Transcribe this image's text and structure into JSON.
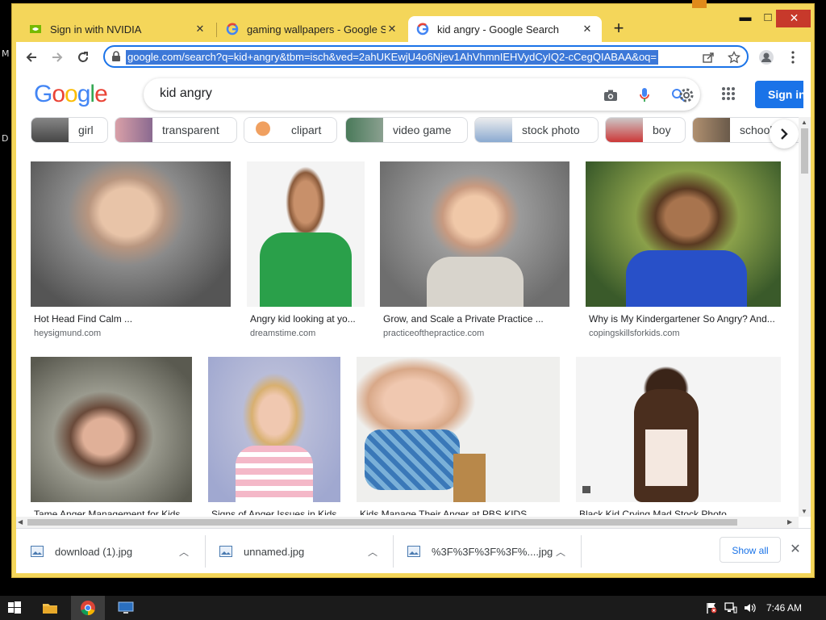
{
  "desktop": {
    "edge_letters": [
      "M",
      "D"
    ]
  },
  "tabs": [
    {
      "title": "Sign in with NVIDIA",
      "close": "✕",
      "favicon": "nvidia-icon"
    },
    {
      "title": "gaming wallpapers - Google Sea",
      "close": "✕",
      "favicon": "google-icon"
    },
    {
      "title": "kid angry - Google Search",
      "close": "✕",
      "favicon": "google-icon"
    }
  ],
  "window_controls": {
    "minimize": "▬",
    "maximize": "□",
    "close": "✕"
  },
  "toolbar": {
    "url": "google.com/search?q=kid+angry&tbm=isch&ved=2ahUKEwjU4o6Njev1AhVhmnIEHVydCyIQ2-cCegQIABAA&oq=",
    "new_tab": "+"
  },
  "google": {
    "logo_letters": [
      "G",
      "o",
      "o",
      "g",
      "l",
      "e"
    ],
    "query": "kid angry",
    "sign_in": "Sign in"
  },
  "chips": [
    {
      "label": "girl"
    },
    {
      "label": "transparent"
    },
    {
      "label": "clipart"
    },
    {
      "label": "video game"
    },
    {
      "label": "stock photo"
    },
    {
      "label": "boy"
    },
    {
      "label": "school"
    }
  ],
  "results": [
    {
      "title": "Hot Head Find Calm ...",
      "source": "heysigmund.com"
    },
    {
      "title": "Angry kid looking at yo...",
      "source": "dreamstime.com"
    },
    {
      "title": "Grow, and Scale a Private Practice ...",
      "source": "practiceofthepractice.com"
    },
    {
      "title": "Why is My Kindergartener So Angry? And...",
      "source": "copingskillsforkids.com"
    },
    {
      "title": "Tame Anger Management for Kids",
      "source": ""
    },
    {
      "title": "Signs of Anger Issues in Kids",
      "source": ""
    },
    {
      "title": "Kids Manage Their Anger at PBS KIDS",
      "source": ""
    },
    {
      "title": "Black Kid Crying Mad Stock Photo",
      "source": ""
    }
  ],
  "downloads": [
    {
      "name": "download (1).jpg"
    },
    {
      "name": "unnamed.jpg"
    },
    {
      "name": "%3F%3F%3F%3F%....jpg"
    }
  ],
  "shelf": {
    "show_all": "Show all",
    "close": "✕"
  },
  "taskbar": {
    "clock": "7:46 AM"
  }
}
